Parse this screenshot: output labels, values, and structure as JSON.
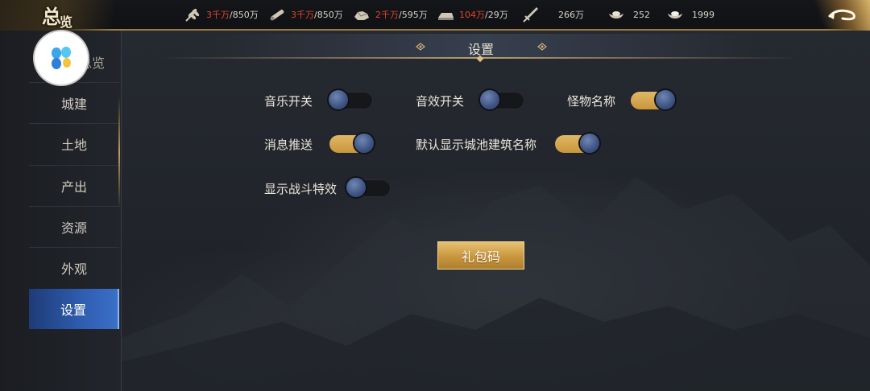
{
  "header": {
    "logo_main": "总",
    "logo_small": "览",
    "resources": [
      {
        "icon": "wheat-icon",
        "current": "3千万",
        "max": "/850万"
      },
      {
        "icon": "wood-icon",
        "current": "3千万",
        "max": "/850万"
      },
      {
        "icon": "stone-icon",
        "current": "2千万",
        "max": "/595万"
      },
      {
        "icon": "iron-ingot-icon",
        "current": "104万",
        "max": "/29万"
      },
      {
        "icon": "sword-icon",
        "value": "266万"
      },
      {
        "icon": "gold-ingot-icon",
        "value": "252"
      },
      {
        "icon": "silver-ingot-icon",
        "value": "1999"
      }
    ],
    "back_icon": "return-arrow-icon"
  },
  "sidebar": {
    "partial_item": "总览",
    "items": [
      {
        "label": "城建"
      },
      {
        "label": "土地"
      },
      {
        "label": "产出"
      },
      {
        "label": "资源"
      },
      {
        "label": "外观"
      },
      {
        "label": "设置"
      }
    ],
    "active_index": 5
  },
  "main": {
    "title": "设置",
    "options": [
      {
        "label": "音乐开关",
        "on": false
      },
      {
        "label": "音效开关",
        "on": false
      },
      {
        "label": "怪物名称",
        "on": true
      },
      {
        "label": "消息推送",
        "on": true
      },
      {
        "label": "默认显示城池建筑名称",
        "on": true
      },
      {
        "label": "显示战斗特效",
        "on": false
      }
    ],
    "gift_button": "礼包码"
  },
  "colors": {
    "accent_gold": "#c8963d",
    "active_tab": "#2f5db0",
    "resource_warning": "#e0452e"
  }
}
